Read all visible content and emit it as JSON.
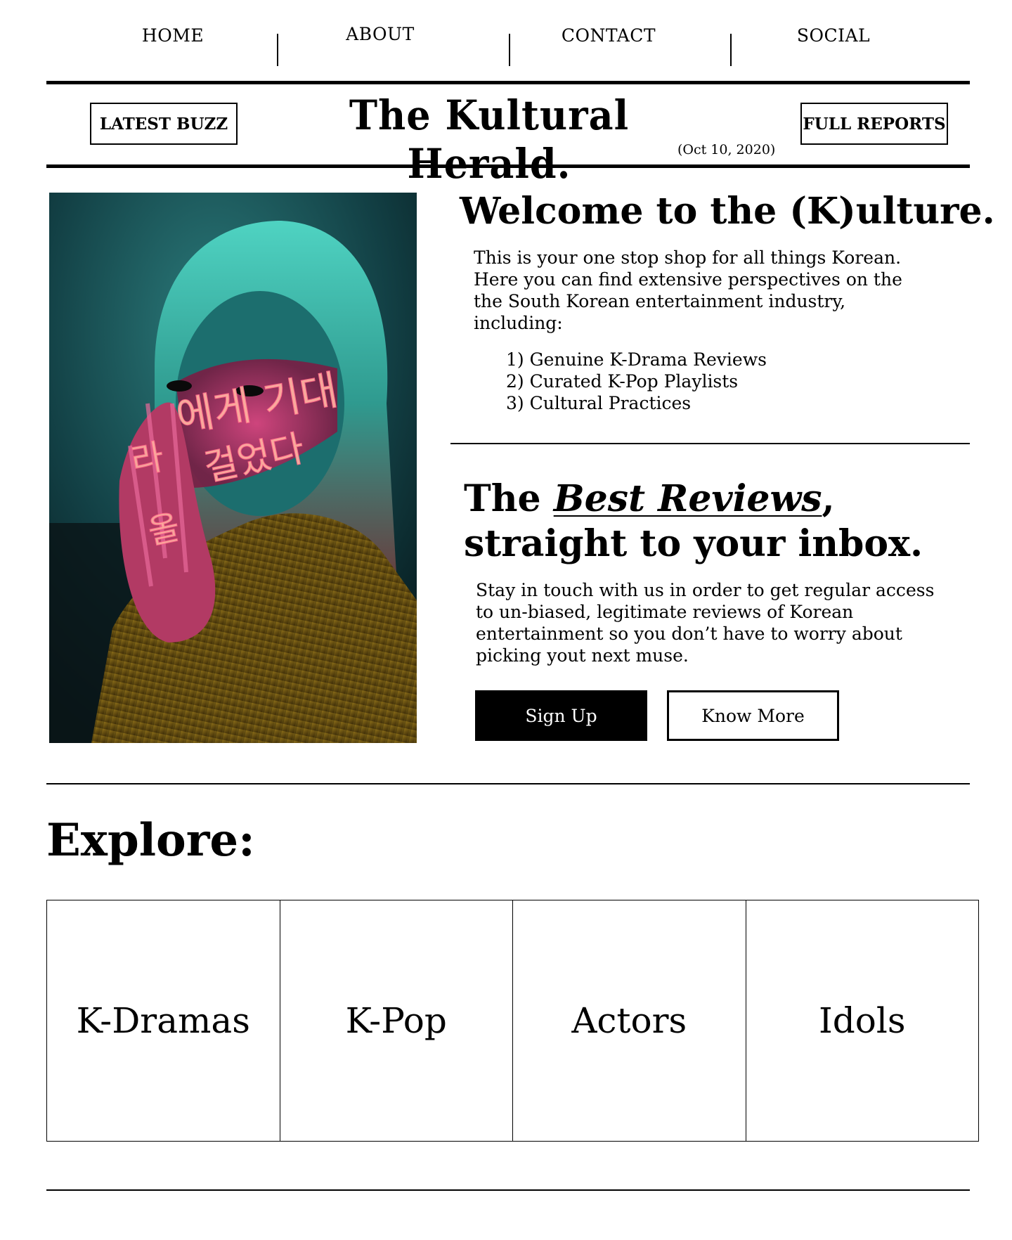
{
  "nav": {
    "items": [
      {
        "label": "HOME"
      },
      {
        "label": "ABOUT"
      },
      {
        "label": "CONTACT"
      },
      {
        "label": "SOCIAL"
      }
    ]
  },
  "masthead": {
    "left_button": "LATEST BUZZ",
    "logo": "The Kultural Herald.",
    "date": "(Oct 10, 2020)",
    "right_button": "FULL REPORTS"
  },
  "hero_image": {
    "overlay_text_1": "에게 기대",
    "overlay_text_2": "걸었다",
    "overlay_text_3": "라",
    "overlay_text_4": "올"
  },
  "welcome": {
    "title": "Welcome to the (K)ulture.",
    "body": "This is your one stop shop for all things Korean. Here you can find extensive perspectives on the the South Korean entertainment industry, including:",
    "list": [
      "1) Genuine K-Drama Reviews",
      "2) Curated K-Pop Playlists",
      "3) Cultural Practices"
    ]
  },
  "reviews": {
    "title_before": "The ",
    "title_emphasis": "Best Reviews",
    "title_after": ", straight to your inbox.",
    "body": "Stay in touch with us in order to get regular access to un-biased, legitimate reviews of Korean entertainment so you don’t have to worry about picking yout next muse.",
    "signup_label": "Sign Up",
    "know_more_label": "Know More"
  },
  "explore": {
    "title": "Explore:",
    "tiles": [
      {
        "label": "K-Dramas"
      },
      {
        "label": "K-Pop"
      },
      {
        "label": "Actors"
      },
      {
        "label": "Idols"
      }
    ]
  },
  "colors": {
    "text": "#000000",
    "background": "#ffffff",
    "photo_teal": "#1d6b6a",
    "photo_pink": "#e0307a",
    "photo_mustard": "#8a6a1a"
  }
}
